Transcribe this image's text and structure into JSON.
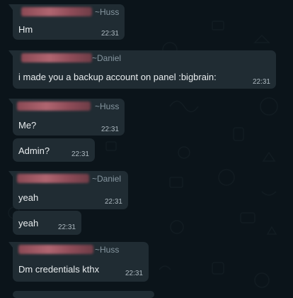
{
  "messages": [
    {
      "handle": "~Huss",
      "text": "Hm",
      "time": "22:31"
    },
    {
      "handle": "~Daniel",
      "text": "i made you a backup account on panel :bigbrain:",
      "time": "22:31"
    },
    {
      "handle": "~Huss",
      "text": "Me?",
      "time": "22:31"
    },
    {
      "text": "Admin?",
      "time": "22:31"
    },
    {
      "handle": "~Daniel",
      "text": "yeah",
      "time": "22:31"
    },
    {
      "text": "yeah",
      "time": "22:31"
    },
    {
      "handle": "~Huss",
      "text": "Dm credentials kthx",
      "time": "22:31"
    }
  ],
  "colors": {
    "background": "#0b141a",
    "bubble": "#202c33",
    "text": "#e9edef",
    "meta": "#8696a0",
    "name_redacted": "#b06570"
  }
}
